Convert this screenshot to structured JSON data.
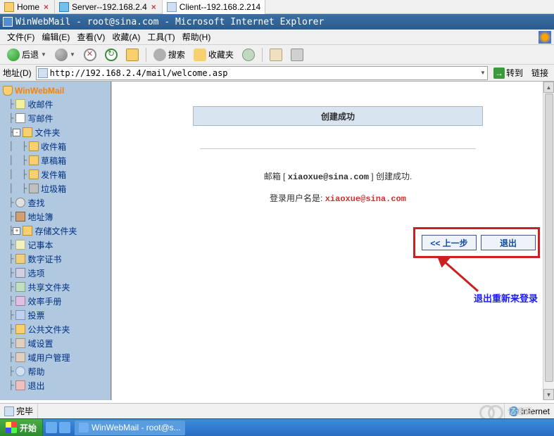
{
  "tabs": [
    {
      "label": "Home",
      "active": false
    },
    {
      "label": "Server--192.168.2.4",
      "active": false
    },
    {
      "label": "Client--192.168.2.214",
      "active": true
    }
  ],
  "window_title": "WinWebMail - root@sina.com - Microsoft Internet Explorer",
  "menu": {
    "file": "文件(F)",
    "edit": "编辑(E)",
    "view": "查看(V)",
    "favorites": "收藏(A)",
    "tools": "工具(T)",
    "help": "帮助(H)"
  },
  "toolbar": {
    "back": "后退",
    "search": "搜索",
    "favorites": "收藏夹"
  },
  "address": {
    "label": "地址(D)",
    "url": "http://192.168.2.4/mail/welcome.asp",
    "go": "转到",
    "links": "链接"
  },
  "sidebar": {
    "root": "WinWebMail",
    "items": [
      {
        "label": "收邮件",
        "icon": "icon-mail",
        "depth": 1
      },
      {
        "label": "写邮件",
        "icon": "icon-write",
        "depth": 1
      },
      {
        "label": "文件夹",
        "icon": "icon-folder",
        "depth": 1,
        "exp": "-"
      },
      {
        "label": "收件箱",
        "icon": "icon-folder",
        "depth": 2
      },
      {
        "label": "草稿箱",
        "icon": "icon-folder",
        "depth": 2
      },
      {
        "label": "发件箱",
        "icon": "icon-folder",
        "depth": 2
      },
      {
        "label": "垃圾箱",
        "icon": "icon-trash",
        "depth": 2
      },
      {
        "label": "查找",
        "icon": "icon-search",
        "depth": 1
      },
      {
        "label": "地址簿",
        "icon": "icon-book",
        "depth": 1
      },
      {
        "label": "存储文件夹",
        "icon": "icon-folder",
        "depth": 1,
        "exp": "+"
      },
      {
        "label": "记事本",
        "icon": "icon-note",
        "depth": 1
      },
      {
        "label": "数字证书",
        "icon": "icon-cert",
        "depth": 1
      },
      {
        "label": "选项",
        "icon": "icon-opt",
        "depth": 1
      },
      {
        "label": "共享文件夹",
        "icon": "icon-share",
        "depth": 1
      },
      {
        "label": "效率手册",
        "icon": "icon-rate",
        "depth": 1
      },
      {
        "label": "投票",
        "icon": "icon-vote",
        "depth": 1
      },
      {
        "label": "公共文件夹",
        "icon": "icon-folder",
        "depth": 1
      },
      {
        "label": "域设置",
        "icon": "icon-domain",
        "depth": 1
      },
      {
        "label": "域用户管理",
        "icon": "icon-domain",
        "depth": 1
      },
      {
        "label": "帮助",
        "icon": "icon-help",
        "depth": 1
      },
      {
        "label": "退出",
        "icon": "icon-exit",
        "depth": 1
      }
    ]
  },
  "main": {
    "banner": "创建成功",
    "msg_prefix": "邮箱 [ ",
    "email": "xiaoxue@sina.com",
    "msg_suffix": " ] 创建成功.",
    "login_prefix": "登录用户名是: ",
    "login_email": "xiaoxue@sina.com",
    "btn_prev": "<< 上一步",
    "btn_exit": "退出",
    "annotation": "退出重新来登录"
  },
  "status": {
    "done": "完毕",
    "zone": "Internet"
  },
  "taskbar": {
    "start": "开始",
    "task": "WinWebMail - root@s..."
  },
  "watermark": "亿速云"
}
